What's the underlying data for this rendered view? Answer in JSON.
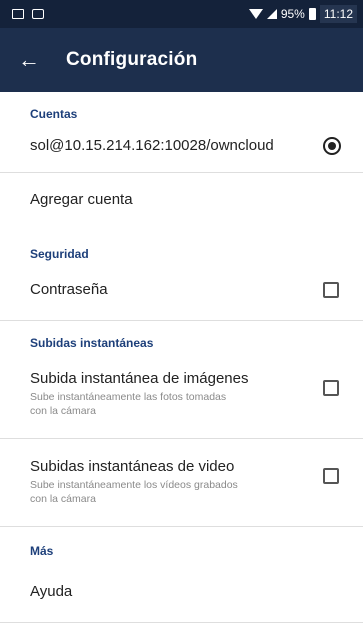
{
  "statusbar": {
    "battery": "95%",
    "time": "11:12",
    "icons": [
      "notification-image-icon",
      "notification-message-icon",
      "wifi-icon",
      "signal-icon",
      "battery-icon"
    ]
  },
  "appbar": {
    "back_icon": "arrow-left-icon",
    "title": "Configuración",
    "background": "#1d2f4d"
  },
  "sections": {
    "accounts": {
      "header": "Cuentas",
      "account": "sol@10.15.214.162:10028/owncloud",
      "account_selected": true,
      "add_account": "Agregar cuenta"
    },
    "security": {
      "header": "Seguridad",
      "password": "Contraseña",
      "password_checked": false
    },
    "instant_uploads": {
      "header": "Subidas instantáneas",
      "images_title": "Subida instantánea de imágenes",
      "images_sub": "Sube instantáneamente las fotos tomadas con la cámara",
      "images_checked": false,
      "videos_title": "Subidas instantáneas de video",
      "videos_sub": "Sube instantáneamente los vídeos grabados con la cámara",
      "videos_checked": false
    },
    "more": {
      "header": "Más",
      "help": "Ayuda"
    }
  },
  "colors": {
    "accent": "#1d3f7a",
    "statusbar": "#14223a"
  }
}
